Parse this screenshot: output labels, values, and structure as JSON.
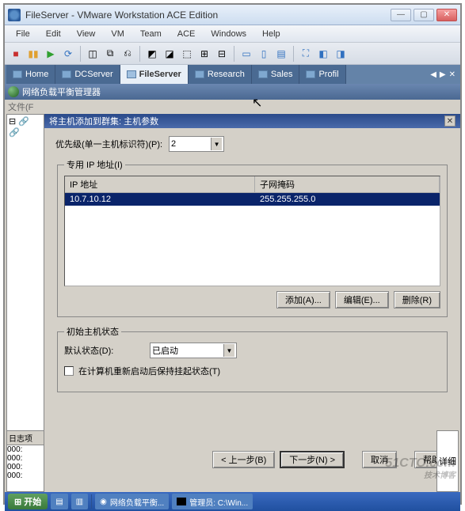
{
  "window": {
    "title": "FileServer - VMware Workstation ACE Edition",
    "btn_min": "—",
    "btn_max": "▢",
    "btn_close": "✕"
  },
  "menu": [
    "File",
    "Edit",
    "View",
    "VM",
    "Team",
    "ACE",
    "Windows",
    "Help"
  ],
  "tabs": {
    "items": [
      {
        "label": "Home"
      },
      {
        "label": "DCServer"
      },
      {
        "label": "FileServer"
      },
      {
        "label": "Research"
      },
      {
        "label": "Sales"
      },
      {
        "label": "Profil"
      }
    ],
    "nav_left": "◀",
    "nav_right": "▶",
    "nav_close": "✕"
  },
  "inner": {
    "title": "网络负载平衡管理器",
    "menu_file": "文件(F"
  },
  "dialog": {
    "title": "将主机添加到群集:    主机参数",
    "close": "✕",
    "priority_label": "优先级(单一主机标识符)(P):",
    "priority_value": "2",
    "ip_legend": "专用 IP 地址(I)",
    "col_ip": "IP 地址",
    "col_mask": "子网掩码",
    "row_ip": "10.7.10.12",
    "row_mask": "255.255.255.0",
    "btn_add": "添加(A)...",
    "btn_edit": "编辑(E)...",
    "btn_remove": "删除(R)",
    "init_legend": "初始主机状态",
    "default_state_label": "默认状态(D):",
    "default_state_value": "已启动",
    "retain_checkbox": "在计算机重新启动后保持挂起状态(T)",
    "btn_back": "< 上一步(B)",
    "btn_next": "下一步(N) >",
    "btn_cancel": "取消",
    "btn_help": "帮助"
  },
  "tree": {
    "root": "⊟ 🔗",
    "child": "   🔗"
  },
  "log": {
    "header": "日志项",
    "lines": [
      "000:",
      "000:",
      "000:",
      "000:"
    ]
  },
  "right_label": "详细",
  "taskbar": {
    "start": "开始",
    "task1": "网络负载平衡...",
    "task2": "管理员: C:\\Win..."
  },
  "watermark": {
    "main": "51CTO.com",
    "sub": "技术博客"
  }
}
